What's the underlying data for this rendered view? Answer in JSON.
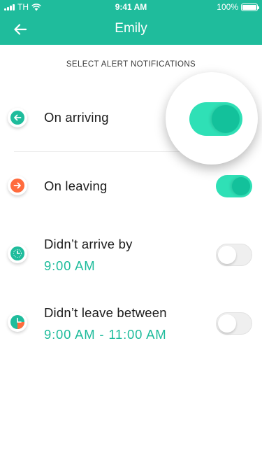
{
  "status_bar": {
    "carrier": "TH",
    "time": "9:41 AM",
    "battery": "100%"
  },
  "nav": {
    "title": "Emily",
    "back_icon": "arrow-left-icon"
  },
  "section_title": "SELECT ALERT NOTIFICATIONS",
  "alerts": [
    {
      "label": "On arriving",
      "sub": "",
      "icon": "arrow-left-circle-icon",
      "icon_color": "#1fbc9c",
      "enabled": true
    },
    {
      "label": "On leaving",
      "sub": "",
      "icon": "arrow-right-circle-icon",
      "icon_color": "#ff6b3d",
      "enabled": true
    },
    {
      "label": "Didn’t arrive by",
      "sub": "9:00 AM",
      "icon": "clock-icon",
      "icon_color": "#1fbc9c",
      "enabled": false
    },
    {
      "label": "Didn’t leave between",
      "sub": "9:00 AM - 11:00 AM",
      "icon": "time-range-icon",
      "icon_color": "#1fbc9c",
      "enabled": false
    }
  ],
  "colors": {
    "brand": "#1fbc9c",
    "toggle_on": "#2fe0b6",
    "toggle_knob_on": "#13c19b",
    "leaving": "#ff6b3d"
  }
}
